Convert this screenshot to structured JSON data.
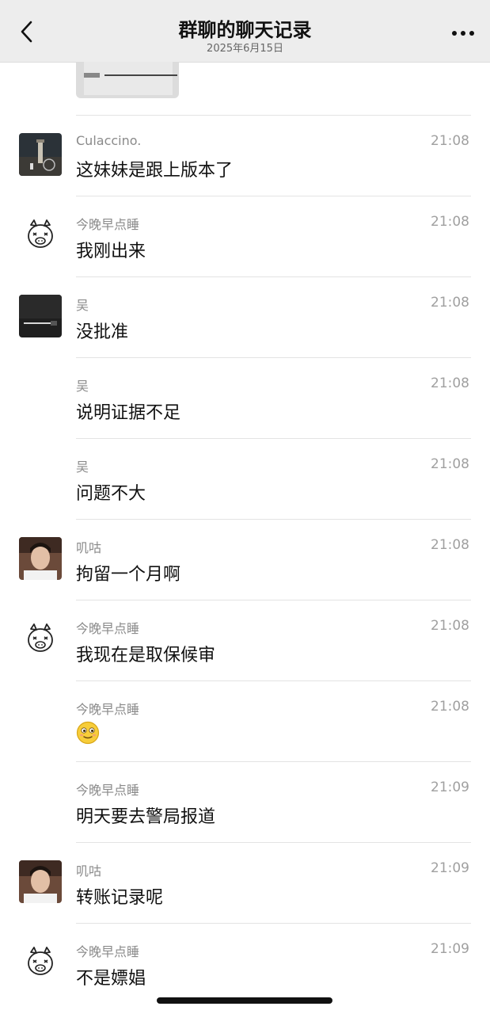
{
  "header": {
    "title": "群聊的聊天记录",
    "date": "2025年6月15日"
  },
  "icons": {
    "back": "chevron-left-icon",
    "more": "more-dots-icon"
  },
  "messages": [
    {
      "sender": "Culaccino.",
      "time": "21:08",
      "text": "这妹妹是跟上版本了",
      "avatar": "lighthouse-photo"
    },
    {
      "sender": "今晚早点睡",
      "time": "21:08",
      "text": "我刚出来",
      "avatar": "pig-face-icon"
    },
    {
      "sender": "吴",
      "time": "21:08",
      "text": "没批准",
      "avatar": "dark-photo"
    },
    {
      "sender": "吴",
      "time": "21:08",
      "text": "说明证据不足",
      "avatar": ""
    },
    {
      "sender": "吴",
      "time": "21:08",
      "text": "问题不大",
      "avatar": ""
    },
    {
      "sender": "叽咕",
      "time": "21:08",
      "text": "拘留一个月啊",
      "avatar": "portrait-photo"
    },
    {
      "sender": "今晚早点睡",
      "time": "21:08",
      "text": "我现在是取保候审",
      "avatar": "pig-face-icon"
    },
    {
      "sender": "今晚早点睡",
      "time": "21:08",
      "text": "",
      "emoji": "smile-emoji",
      "avatar": ""
    },
    {
      "sender": "今晚早点睡",
      "time": "21:09",
      "text": "明天要去警局报道",
      "avatar": ""
    },
    {
      "sender": "叽咕",
      "time": "21:09",
      "text": "转账记录呢",
      "avatar": "portrait-photo"
    },
    {
      "sender": "今晚早点睡",
      "time": "21:09",
      "text": "不是嫖娼",
      "avatar": "pig-face-icon"
    }
  ]
}
